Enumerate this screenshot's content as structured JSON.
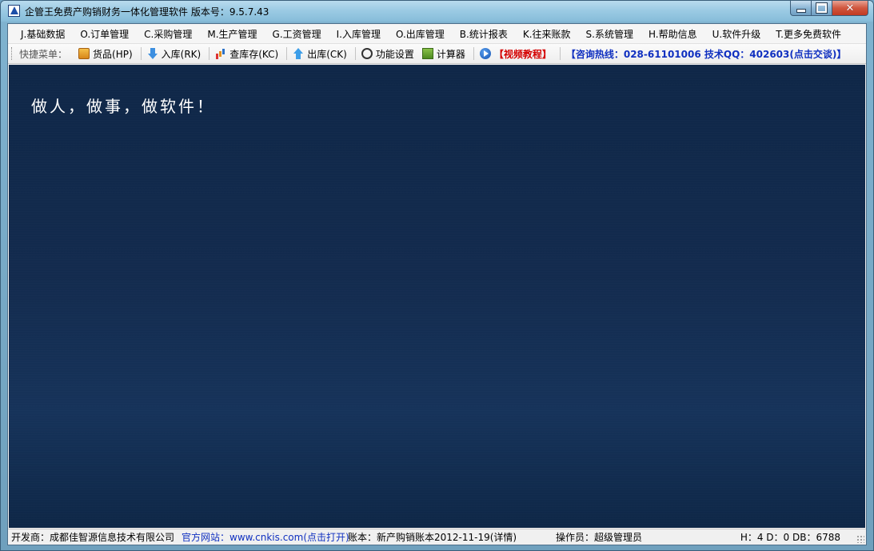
{
  "window": {
    "title": "企管王免费产购销财务一体化管理软件 版本号：9.5.7.43"
  },
  "menu": [
    "J.基础数据",
    "O.订单管理",
    "C.采购管理",
    "M.生产管理",
    "G.工资管理",
    "I.入库管理",
    "O.出库管理",
    "B.统计报表",
    "K.往来账款",
    "S.系统管理",
    "H.帮助信息",
    "U.软件升级",
    "T.更多免费软件"
  ],
  "toolbar": {
    "label": "快捷菜单：",
    "goods": "货品(HP)",
    "inbound": "入库(RK)",
    "stock": "查库存(KC)",
    "outbound": "出库(CK)",
    "settings": "功能设置",
    "calculator": "计算器",
    "video": "【视频教程】",
    "hotline": "【咨询热线：028-61101006 技术QQ：402603(点击交谈)】"
  },
  "main": {
    "slogan": "做人，做事，做软件！"
  },
  "status": {
    "developer": "开发商：成都佳智源信息技术有限公司",
    "website": "官方网站：www.cnkis.com(点击打开)",
    "account": "账本：新产购销账本2012-11-19(详情)",
    "operator": "操作员：超级管理员",
    "db": "H：4 D：0 DB：6788"
  },
  "colors": {
    "main_bg": "#132b4e",
    "link_blue": "#1030c0",
    "video_red": "#d40000"
  },
  "icons": {
    "goods": "goods-box-icon",
    "inbound": "arrow-down-icon",
    "stock": "bar-chart-icon",
    "outbound": "arrow-up-icon",
    "settings": "gear-icon",
    "calculator": "calculator-icon",
    "video": "play-icon"
  }
}
